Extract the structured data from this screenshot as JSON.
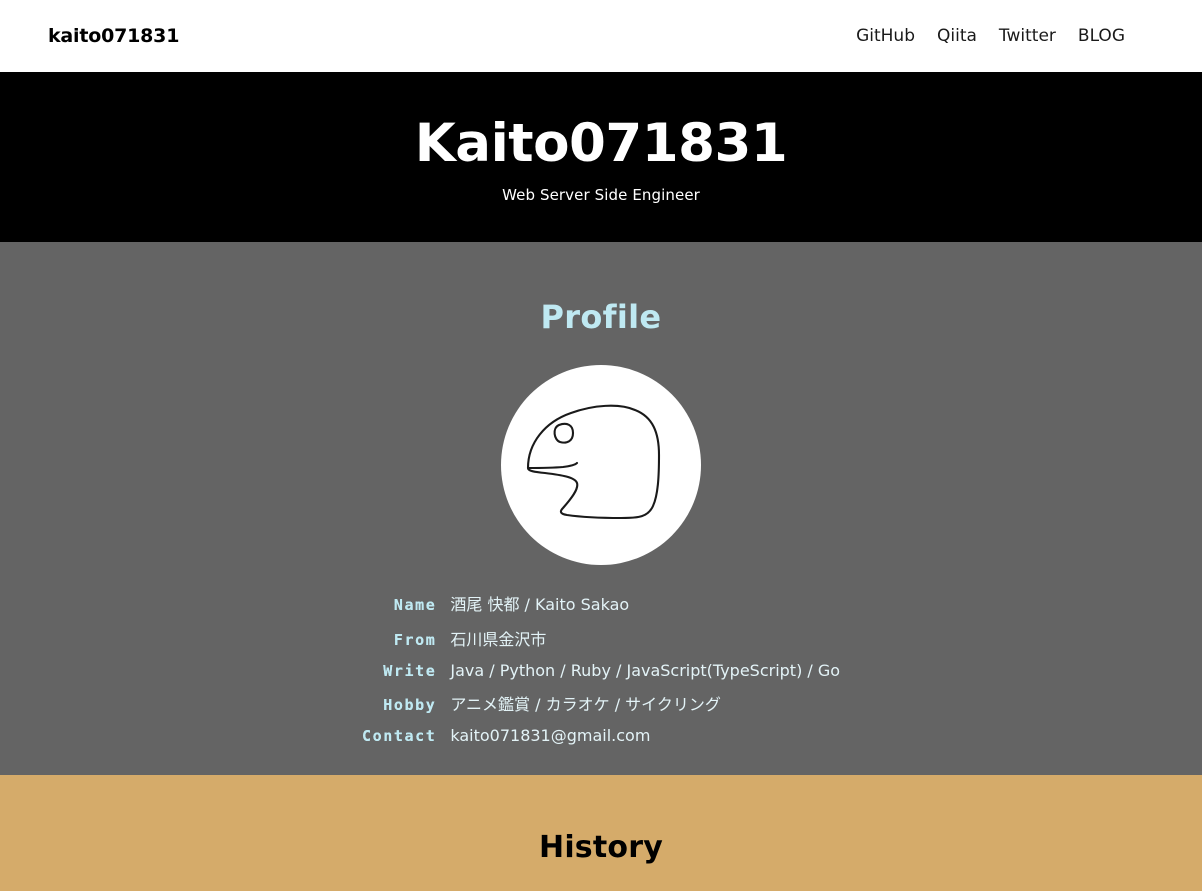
{
  "navbar": {
    "brand": "kaito071831",
    "links": [
      {
        "label": "GitHub",
        "name": "nav-link-github"
      },
      {
        "label": "Qiita",
        "name": "nav-link-qiita"
      },
      {
        "label": "Twitter",
        "name": "nav-link-twitter"
      },
      {
        "label": "BLOG",
        "name": "nav-link-blog"
      }
    ]
  },
  "hero": {
    "title": "Kaito071831",
    "subtitle": "Web Server Side Engineer",
    "background_color": "#000000",
    "text_color": "#ffffff"
  },
  "profile": {
    "section_title": "Profile",
    "section_title_color": "#bfe9f2",
    "background_color": "#646464",
    "avatar": {
      "icon": "hand-drawn-blob-avatar",
      "background_color": "#ffffff",
      "stroke_color": "#1a1a1a"
    },
    "rows": [
      {
        "label": "Name",
        "value": "酒尾 快都 / Kaito Sakao"
      },
      {
        "label": "From",
        "value": "石川県金沢市"
      },
      {
        "label": "Write",
        "value": "Java / Python / Ruby / JavaScript(TypeScript) / Go"
      },
      {
        "label": "Hobby",
        "value": "アニメ鑑賞 / カラオケ / サイクリング"
      },
      {
        "label": "Contact",
        "value": "kaito071831@gmail.com"
      }
    ]
  },
  "history": {
    "section_title": "History",
    "background_color": "#d5ab6a",
    "text_color": "#000000"
  }
}
